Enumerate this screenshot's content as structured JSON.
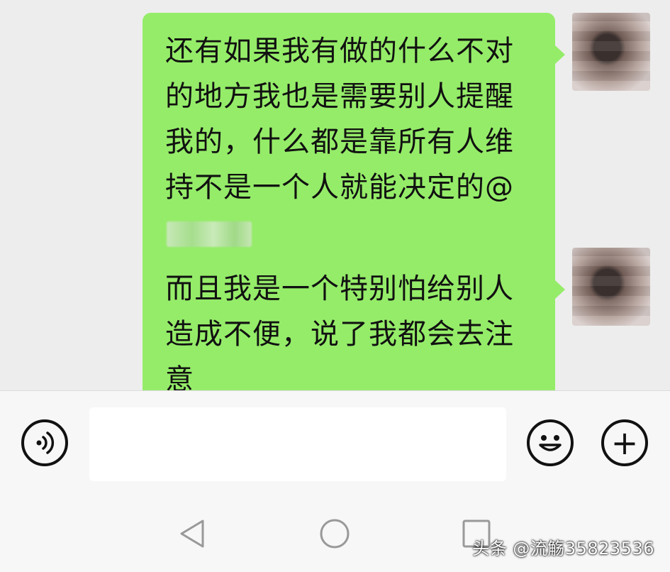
{
  "messages": [
    {
      "text": "还有如果我有做的什么不对的地方我也是需要别人提醒我的，什么都是靠所有人维持不是一个人就能决定的@"
    },
    {
      "text": "而且我是一个特别怕给别人造成不便，说了我都会去注意"
    }
  ],
  "colors": {
    "bubble": "#95ec69",
    "background": "#ededed",
    "input_bar": "#f7f7f7"
  },
  "input_bar": {
    "voice_icon": "voice-icon",
    "emoji_icon": "emoji-icon",
    "plus_icon": "plus-icon",
    "plus_glyph": "+",
    "input_value": ""
  },
  "nav": {
    "back_icon": "back-triangle-icon",
    "home_icon": "home-circle-icon",
    "recent_icon": "recent-square-icon"
  },
  "watermark": "头条 @流觞35823536"
}
